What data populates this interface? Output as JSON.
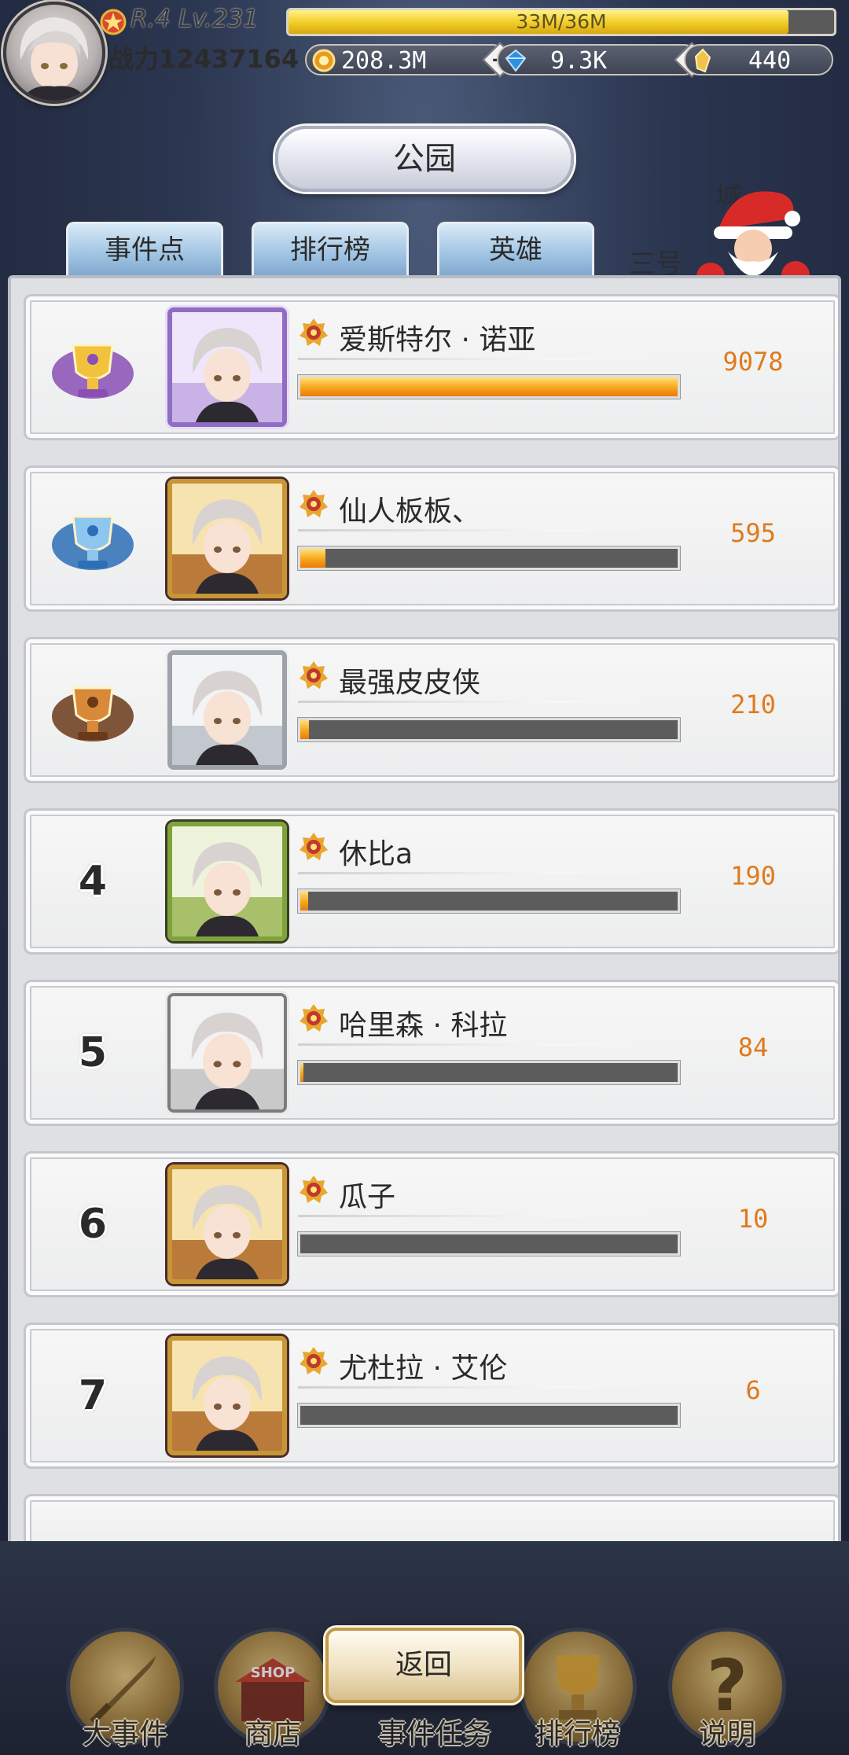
{
  "hud": {
    "level_text": "R.4 Lv.231",
    "power_text": "战力12437164",
    "xp_text": "33M/36M",
    "xp_fraction": 0.917,
    "gold": "208.3M",
    "diamond": "9.3K",
    "crystal": "440",
    "colors": {
      "gold": "#f0a823",
      "diamond": "#3aa0e8",
      "crystal": "#f3c94a"
    }
  },
  "page": {
    "title": "公园",
    "tabs": [
      "事件点",
      "排行榜",
      "英雄"
    ],
    "city_label": "城",
    "side_label": "三号"
  },
  "ranking": [
    {
      "rank": "1",
      "name": "爱斯特尔 · 诺亚",
      "score": "9078",
      "fill": 1.0,
      "frame": "purple",
      "trophy": "gold"
    },
    {
      "rank": "2",
      "name": "仙人板板、",
      "score": "595",
      "fill": 0.066,
      "frame": "gold",
      "trophy": "silver"
    },
    {
      "rank": "3",
      "name": "最强皮皮侠",
      "score": "210",
      "fill": 0.023,
      "frame": "silver",
      "trophy": "bronze"
    },
    {
      "rank": "4",
      "name": "休比a",
      "score": "190",
      "fill": 0.021,
      "frame": "green"
    },
    {
      "rank": "5",
      "name": "哈里森 · 科拉",
      "score": "84",
      "fill": 0.009,
      "frame": "plain"
    },
    {
      "rank": "6",
      "name": "瓜子",
      "score": "10",
      "fill": 0.0,
      "frame": "gold"
    },
    {
      "rank": "7",
      "name": "尤杜拉 · 艾伦",
      "score": "6",
      "fill": 0.0,
      "frame": "gold"
    }
  ],
  "bottom": {
    "return_label": "返回",
    "nav": [
      "大事件",
      "商店",
      "事件任务",
      "排行榜",
      "说明"
    ],
    "shop_sign": "SHOP"
  },
  "icons": [
    "rank-emblem-icon",
    "gold-coin-icon",
    "diamond-icon",
    "crystal-icon",
    "trophy-icon",
    "sword-icon",
    "shop-icon",
    "question-icon",
    "santa-icon"
  ]
}
